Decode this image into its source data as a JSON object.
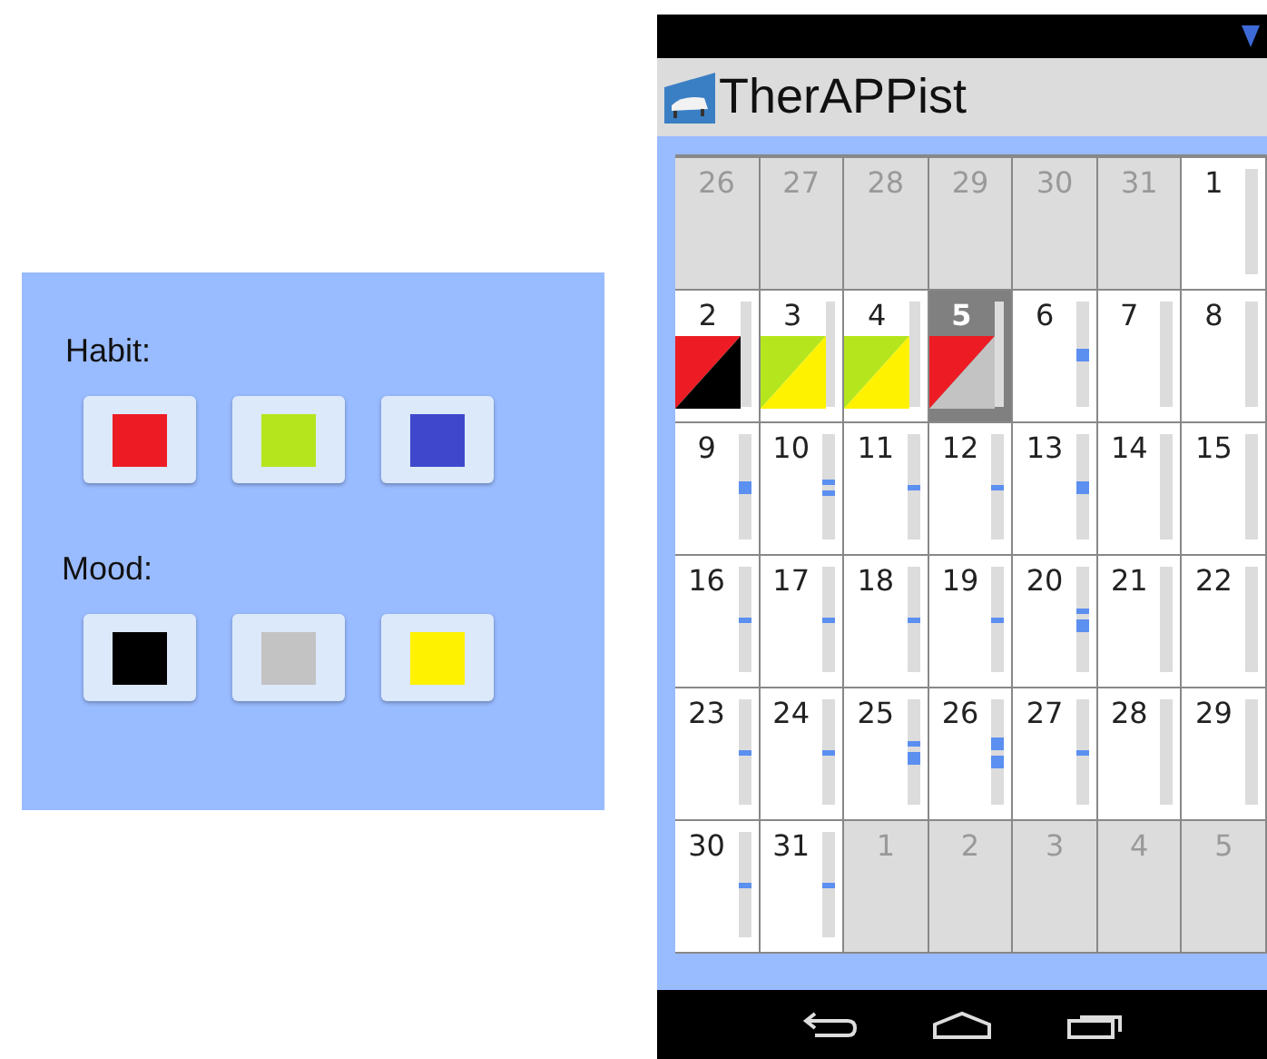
{
  "palette": {
    "habit_label": "Habit:",
    "habit": [
      {
        "color": "#ed1c24"
      },
      {
        "color": "#b5e61d"
      },
      {
        "color": "#3f48cc"
      }
    ],
    "mood_label": "Mood:",
    "mood": [
      {
        "color": "#000000"
      },
      {
        "color": "#c3c3c3"
      },
      {
        "color": "#fff200"
      }
    ]
  },
  "app": {
    "title": "TherAPPist"
  },
  "calendar": {
    "days": [
      {
        "label": "26",
        "in_month": false,
        "selected": false
      },
      {
        "label": "27",
        "in_month": false,
        "selected": false
      },
      {
        "label": "28",
        "in_month": false,
        "selected": false
      },
      {
        "label": "29",
        "in_month": false,
        "selected": false
      },
      {
        "label": "30",
        "in_month": false,
        "selected": false
      },
      {
        "label": "31",
        "in_month": false,
        "selected": false
      },
      {
        "label": "1",
        "in_month": true,
        "selected": false
      },
      {
        "label": "2",
        "in_month": true,
        "selected": false,
        "habit": {
          "color": "#ed1c24"
        },
        "mood": {
          "color": "#000000"
        }
      },
      {
        "label": "3",
        "in_month": true,
        "selected": false,
        "habit": {
          "color": "#b5e61d"
        },
        "mood": {
          "color": "#fff200"
        }
      },
      {
        "label": "4",
        "in_month": true,
        "selected": false,
        "habit": {
          "color": "#b5e61d"
        },
        "mood": {
          "color": "#fff200"
        }
      },
      {
        "label": "5",
        "in_month": true,
        "selected": true,
        "habit": {
          "color": "#ed1c24"
        },
        "mood": {
          "color": "#c3c3c3"
        }
      },
      {
        "label": "6",
        "in_month": true,
        "selected": false,
        "marks": [
          {
            "kind": "block"
          }
        ]
      },
      {
        "label": "7",
        "in_month": true,
        "selected": false
      },
      {
        "label": "8",
        "in_month": true,
        "selected": false
      },
      {
        "label": "9",
        "in_month": true,
        "selected": false,
        "marks": [
          {
            "kind": "block"
          }
        ]
      },
      {
        "label": "10",
        "in_month": true,
        "selected": false,
        "marks": [
          {
            "kind": "dash"
          },
          {
            "kind": "dash"
          }
        ]
      },
      {
        "label": "11",
        "in_month": true,
        "selected": false,
        "marks": [
          {
            "kind": "dash"
          }
        ]
      },
      {
        "label": "12",
        "in_month": true,
        "selected": false,
        "marks": [
          {
            "kind": "dash"
          }
        ]
      },
      {
        "label": "13",
        "in_month": true,
        "selected": false,
        "marks": [
          {
            "kind": "block"
          }
        ]
      },
      {
        "label": "14",
        "in_month": true,
        "selected": false
      },
      {
        "label": "15",
        "in_month": true,
        "selected": false
      },
      {
        "label": "16",
        "in_month": true,
        "selected": false,
        "marks": [
          {
            "kind": "dash"
          }
        ]
      },
      {
        "label": "17",
        "in_month": true,
        "selected": false,
        "marks": [
          {
            "kind": "dash"
          }
        ]
      },
      {
        "label": "18",
        "in_month": true,
        "selected": false,
        "marks": [
          {
            "kind": "dash"
          }
        ]
      },
      {
        "label": "19",
        "in_month": true,
        "selected": false,
        "marks": [
          {
            "kind": "dash"
          }
        ]
      },
      {
        "label": "20",
        "in_month": true,
        "selected": false,
        "marks": [
          {
            "kind": "dash"
          },
          {
            "kind": "block"
          }
        ]
      },
      {
        "label": "21",
        "in_month": true,
        "selected": false
      },
      {
        "label": "22",
        "in_month": true,
        "selected": false
      },
      {
        "label": "23",
        "in_month": true,
        "selected": false,
        "marks": [
          {
            "kind": "dash"
          }
        ]
      },
      {
        "label": "24",
        "in_month": true,
        "selected": false,
        "marks": [
          {
            "kind": "dash"
          }
        ]
      },
      {
        "label": "25",
        "in_month": true,
        "selected": false,
        "marks": [
          {
            "kind": "dash"
          },
          {
            "kind": "block"
          }
        ]
      },
      {
        "label": "26",
        "in_month": true,
        "selected": false,
        "marks": [
          {
            "kind": "block"
          },
          {
            "kind": "block"
          }
        ]
      },
      {
        "label": "27",
        "in_month": true,
        "selected": false,
        "marks": [
          {
            "kind": "dash"
          }
        ]
      },
      {
        "label": "28",
        "in_month": true,
        "selected": false
      },
      {
        "label": "29",
        "in_month": true,
        "selected": false
      },
      {
        "label": "30",
        "in_month": true,
        "selected": false,
        "marks": [
          {
            "kind": "dash"
          }
        ]
      },
      {
        "label": "31",
        "in_month": true,
        "selected": false,
        "marks": [
          {
            "kind": "dash"
          }
        ]
      },
      {
        "label": "1",
        "in_month": false,
        "selected": false
      },
      {
        "label": "2",
        "in_month": false,
        "selected": false
      },
      {
        "label": "3",
        "in_month": false,
        "selected": false
      },
      {
        "label": "4",
        "in_month": false,
        "selected": false
      },
      {
        "label": "5",
        "in_month": false,
        "selected": false
      }
    ]
  }
}
